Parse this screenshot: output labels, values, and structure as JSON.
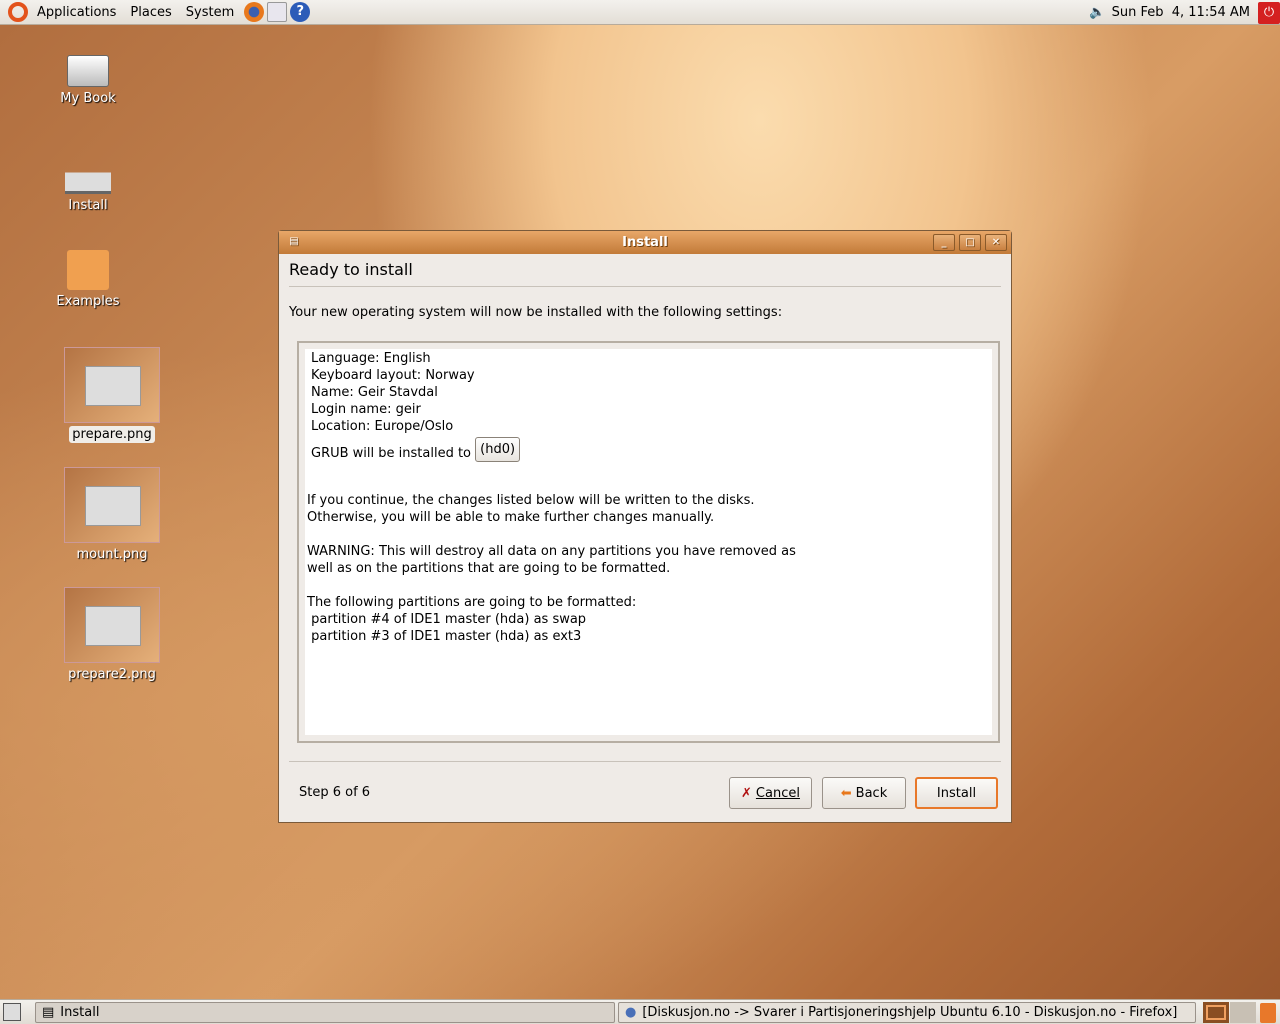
{
  "top_panel": {
    "menus": [
      "Applications",
      "Places",
      "System"
    ],
    "clock": "Sun Feb  4, 11:54 AM"
  },
  "desktop": {
    "icons": [
      "My Book",
      "Install",
      "Examples",
      "prepare.png",
      "mount.png",
      "prepare2.png"
    ]
  },
  "window": {
    "title": "Install",
    "heading": "Ready to install",
    "intro": "Your new operating system will now be installed with the following settings:",
    "settings": [
      "Language: English",
      "Keyboard layout: Norway",
      "Name: Geir Stavdal",
      "Login name: geir",
      "Location: Europe/Oslo"
    ],
    "grub_label": "GRUB will be installed to",
    "grub_value": "(hd0)",
    "lines": [
      "If you continue, the changes listed below will be written to the disks.",
      "Otherwise, you will be able to make further changes manually.",
      "",
      "WARNING: This will destroy all data on any partitions you have removed as",
      "well as on the partitions that are going to be formatted.",
      "",
      "The following partitions are going to be formatted:",
      " partition #4 of IDE1 master (hda) as swap",
      " partition #3 of IDE1 master (hda) as ext3"
    ],
    "step": "Step 6 of 6",
    "cancel": "Cancel",
    "back": "Back",
    "install": "Install"
  },
  "taskbar": {
    "tasks": [
      "Install",
      "[Diskusjon.no -> Svarer i Partisjoneringshjelp Ubuntu 6.10 - Diskusjon.no - Firefox]"
    ]
  },
  "colors": {
    "accent": "#c27a38",
    "install_border": "#e8782a"
  }
}
